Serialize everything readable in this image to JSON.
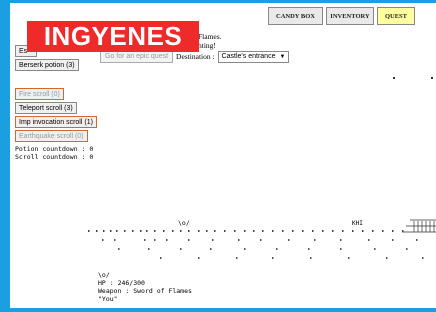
{
  "nav": {
    "candy_box": "CANDY BOX",
    "inventory": "INVENTORY",
    "quest": "QUEST"
  },
  "banner": "INGYENES",
  "status": {
    "line1": "Flames.",
    "line2": "hting!"
  },
  "quest": {
    "go_button": "Go for an epic quest",
    "destination_label": "Destination :",
    "destination_value": "Castle's entrance"
  },
  "left_buttons": {
    "es": "Es",
    "berserk": "Berserk potion (3)",
    "fire": "Fire scroll (0)",
    "teleport": "Teleport scroll (3)",
    "imp": "Imp invocation scroll (1)",
    "earthquake": "Earthquake scroll (0)"
  },
  "countdowns": {
    "potion": "Potion countdown : 0",
    "scroll": "Scroll countdown : 0"
  },
  "map": {
    "player_glyph": "\\o/",
    "enemy_label": "KHI"
  },
  "hero": {
    "glyph": "\\o/",
    "hp": "HP : 246/300",
    "weapon": "Weapon : Sword of Flames",
    "name": "\"You\""
  },
  "colors": {
    "frame": "#1a9fe0",
    "banner": "#ee2a2a",
    "quest_tab": "#ffffa0",
    "highlight_border": "#d2692a"
  }
}
